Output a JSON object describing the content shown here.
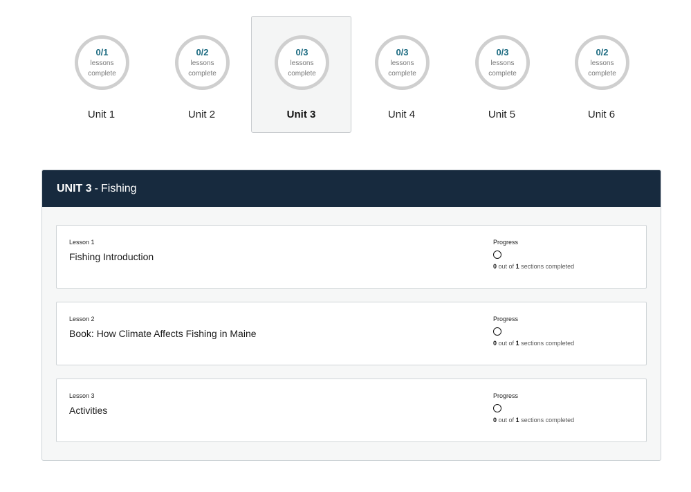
{
  "units": [
    {
      "count": "0/1",
      "label_line1": "lessons",
      "label_line2": "complete",
      "name": "Unit 1"
    },
    {
      "count": "0/2",
      "label_line1": "lessons",
      "label_line2": "complete",
      "name": "Unit 2"
    },
    {
      "count": "0/3",
      "label_line1": "lessons",
      "label_line2": "complete",
      "name": "Unit 3"
    },
    {
      "count": "0/3",
      "label_line1": "lessons",
      "label_line2": "complete",
      "name": "Unit 4"
    },
    {
      "count": "0/3",
      "label_line1": "lessons",
      "label_line2": "complete",
      "name": "Unit 5"
    },
    {
      "count": "0/2",
      "label_line1": "lessons",
      "label_line2": "complete",
      "name": "Unit 6"
    }
  ],
  "selected_unit_index": 2,
  "panel": {
    "unit_code": "UNIT 3",
    "separator": "-",
    "unit_title": "Fishing"
  },
  "lessons": [
    {
      "number": "Lesson 1",
      "title": "Fishing Introduction",
      "progress_label": "Progress",
      "completed": "0",
      "out_of_text": "out of",
      "total": "1",
      "suffix_text": "sections completed"
    },
    {
      "number": "Lesson 2",
      "title": "Book: How Climate Affects Fishing in Maine",
      "progress_label": "Progress",
      "completed": "0",
      "out_of_text": "out of",
      "total": "1",
      "suffix_text": "sections completed"
    },
    {
      "number": "Lesson 3",
      "title": "Activities",
      "progress_label": "Progress",
      "completed": "0",
      "out_of_text": "out of",
      "total": "1",
      "suffix_text": "sections completed"
    }
  ],
  "colors": {
    "header_bg": "#172a3e",
    "ring_count": "#1b6a80",
    "ring_border": "#cfcfcf"
  }
}
